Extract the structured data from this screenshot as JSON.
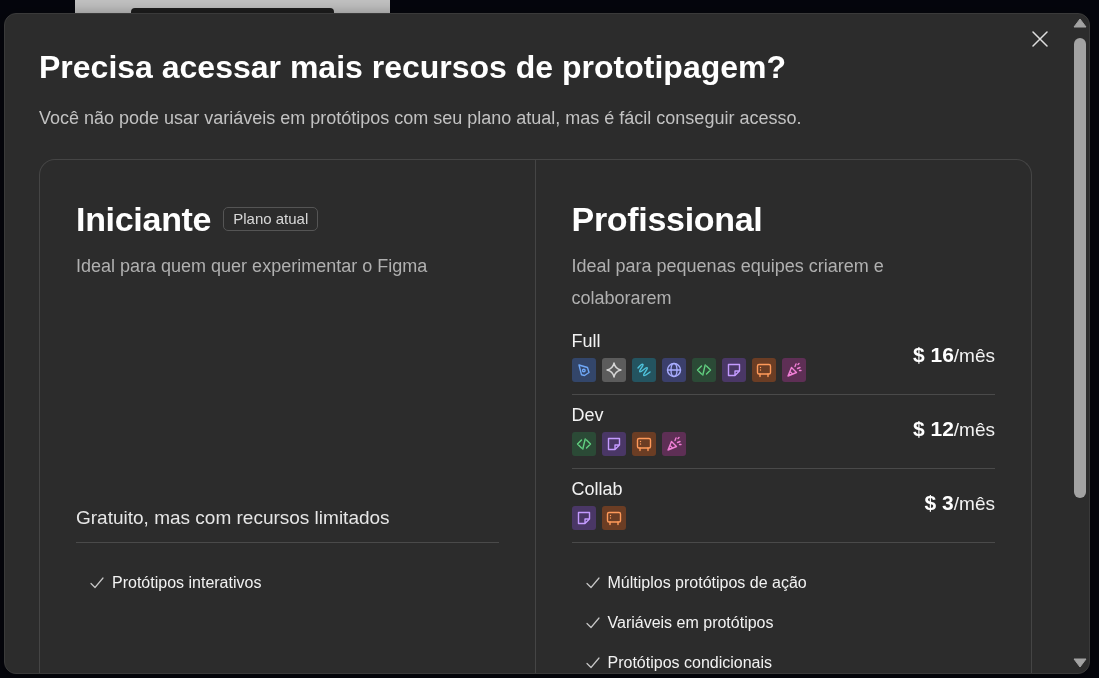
{
  "dialog": {
    "title": "Precisa acessar mais recursos de prototipagem?",
    "subtitle": "Você não pode usar variáveis em protótipos com seu plano atual, mas é fácil conseguir acesso."
  },
  "plans": [
    {
      "name": "Iniciante",
      "badge": "Plano atual",
      "description": "Ideal para quem quer experimentar o Figma",
      "price_note": "Gratuito, mas com recursos limitados",
      "features": [
        "Protótipos interativos"
      ]
    },
    {
      "name": "Profissional",
      "description": "Ideal para pequenas equipes criarem e colaborarem",
      "seats": [
        {
          "name": "Full",
          "price": "**$ 16**/mês",
          "products": [
            {
              "kind": "pen"
            },
            {
              "kind": "star"
            },
            {
              "kind": "squiggle"
            },
            {
              "kind": "globe"
            },
            {
              "kind": "code"
            },
            {
              "kind": "note"
            },
            {
              "kind": "board"
            },
            {
              "kind": "popper"
            }
          ]
        },
        {
          "name": "Dev",
          "price": "**$ 12**/mês",
          "products": [
            {
              "kind": "code"
            },
            {
              "kind": "note"
            },
            {
              "kind": "board"
            },
            {
              "kind": "popper"
            }
          ]
        },
        {
          "name": "Collab",
          "price": "**$ 3**/mês",
          "products": [
            {
              "kind": "note"
            },
            {
              "kind": "board"
            }
          ]
        }
      ],
      "features": [
        "Múltiplos protótipos de ação",
        "Variáveis em protótipos",
        "Protótipos condicionais"
      ]
    }
  ]
}
